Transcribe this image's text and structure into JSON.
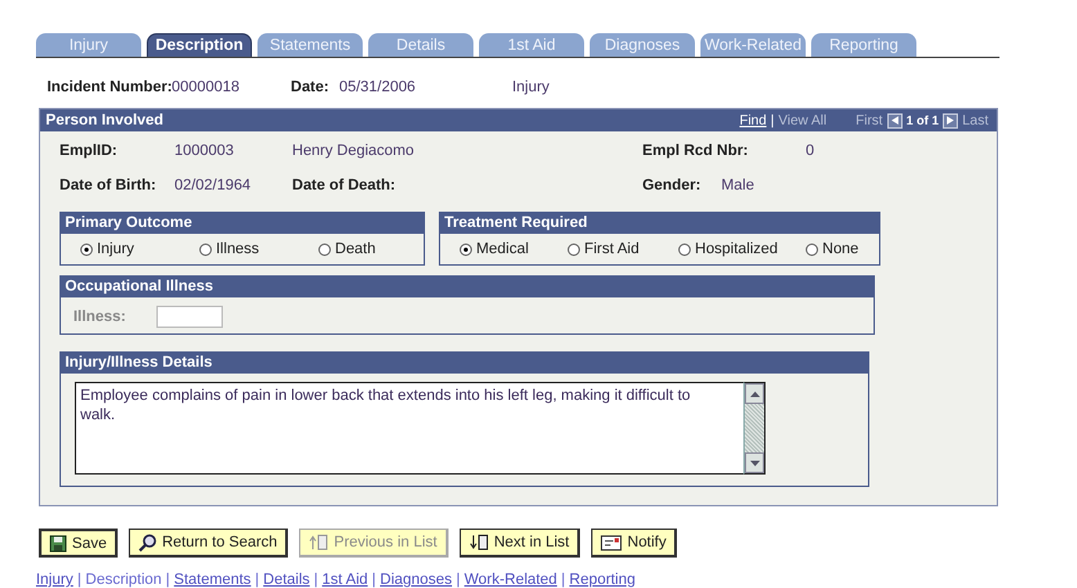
{
  "tabs": [
    {
      "label": "Injury",
      "selected": false
    },
    {
      "label": "Description",
      "selected": true
    },
    {
      "label": "Statements",
      "selected": false
    },
    {
      "label": "Details",
      "selected": false
    },
    {
      "label": "1st Aid",
      "selected": false
    },
    {
      "label": "Diagnoses",
      "selected": false
    },
    {
      "label": "Work-Related",
      "selected": false
    },
    {
      "label": "Reporting",
      "selected": false
    }
  ],
  "incident": {
    "number_label": "Incident Number:",
    "number": "00000018",
    "date_label": "Date:",
    "date": "05/31/2006",
    "type": "Injury"
  },
  "person_involved": {
    "title": "Person Involved",
    "nav": {
      "find": "Find",
      "separator": "|",
      "view_all": "View All",
      "first": "First",
      "count": "1 of 1",
      "last": "Last"
    },
    "emplid_label": "EmplID:",
    "emplid": "1000003",
    "name": "Henry Degiacomo",
    "empl_rcd_label": "Empl Rcd Nbr:",
    "empl_rcd": "0",
    "birth_label": "Date of Birth:",
    "birth": "02/02/1964",
    "death_label": "Date of Death:",
    "gender_label": "Gender:",
    "gender": "Male",
    "primary_outcome": {
      "title": "Primary Outcome",
      "options": [
        {
          "label": "Injury",
          "selected": true
        },
        {
          "label": "Illness",
          "selected": false
        },
        {
          "label": "Death",
          "selected": false
        }
      ]
    },
    "treatment_required": {
      "title": "Treatment Required",
      "options": [
        {
          "label": "Medical",
          "selected": true
        },
        {
          "label": "First Aid",
          "selected": false
        },
        {
          "label": "Hospitalized",
          "selected": false
        },
        {
          "label": "None",
          "selected": false
        }
      ]
    },
    "occupational_illness": {
      "title": "Occupational Illness",
      "label": "Illness:",
      "disabled": true
    },
    "details": {
      "title": "Injury/Illness Details",
      "text": "Employee complains of pain in lower back that extends into his left leg, making it difficult to walk."
    }
  },
  "buttons": [
    {
      "label": "Save",
      "kind": "save",
      "disabled": false
    },
    {
      "label": "Return to Search",
      "kind": "search",
      "disabled": false
    },
    {
      "label": "Previous in List",
      "kind": "previous",
      "disabled": true
    },
    {
      "label": "Next in List",
      "kind": "next",
      "disabled": false
    },
    {
      "label": "Notify",
      "kind": "notify",
      "disabled": false
    }
  ],
  "footer_links": [
    {
      "label": "Injury",
      "selected": false
    },
    {
      "separator": "|",
      "label": "Description",
      "selected": true
    },
    {
      "separator": "|",
      "label": "Statements",
      "selected": false
    },
    {
      "separator": "|",
      "label": "Details",
      "selected": false
    },
    {
      "separator": "|",
      "label": "1st Aid",
      "selected": false
    },
    {
      "separator": "|",
      "label": "Diagnoses",
      "selected": false
    },
    {
      "separator": "|",
      "label": "Work-Related",
      "selected": false
    },
    {
      "separator": "|",
      "label": "Reporting",
      "selected": false
    }
  ]
}
